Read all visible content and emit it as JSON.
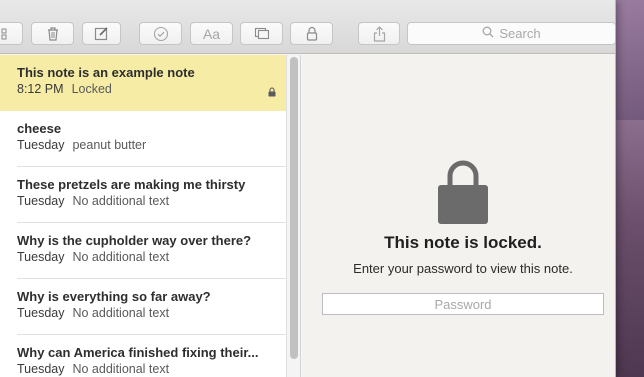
{
  "toolbar": {
    "search_placeholder": "Search",
    "buttons": [
      "sidebar-icon",
      "trash-icon",
      "compose-icon",
      "checklist-icon",
      "font-icon",
      "attachment-icon",
      "lock-icon",
      "share-icon"
    ],
    "font_label": "Aa"
  },
  "notes": [
    {
      "title": "This note is an example note",
      "date": "8:12 PM",
      "preview": "Locked",
      "selected": true,
      "locked": true
    },
    {
      "title": "cheese",
      "date": "Tuesday",
      "preview": "peanut butter"
    },
    {
      "title": "These pretzels are making me thirsty",
      "date": "Tuesday",
      "preview": "No additional text"
    },
    {
      "title": "Why is the cupholder way over there?",
      "date": "Tuesday",
      "preview": "No additional text"
    },
    {
      "title": "Why is everything so far away?",
      "date": "Tuesday",
      "preview": "No additional text"
    },
    {
      "title": "Why can America finished fixing their...",
      "date": "Tuesday",
      "preview": "No additional text"
    }
  ],
  "locked_view": {
    "title": "This note is locked.",
    "subtitle": "Enter your password to view this note.",
    "password_placeholder": "Password",
    "password_value": ""
  },
  "colors": {
    "selected_row": "#f6eca6",
    "lock_icon": "#6b6b6b"
  }
}
